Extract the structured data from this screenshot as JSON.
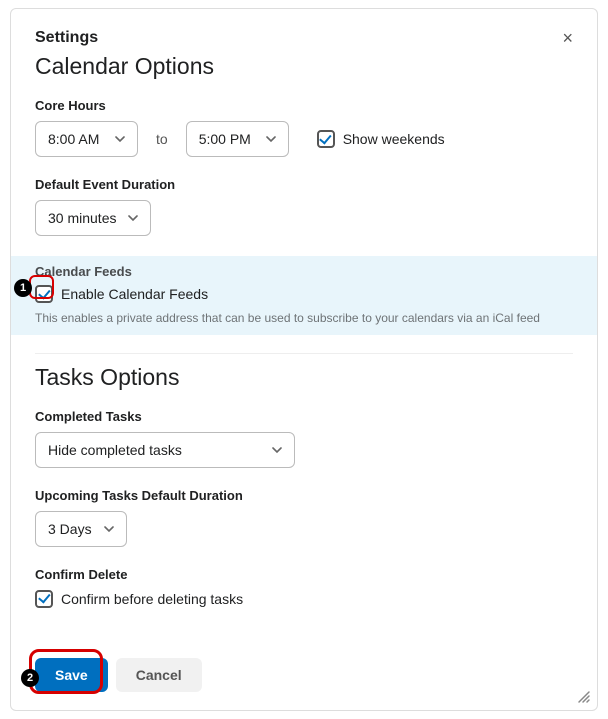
{
  "header": {
    "title": "Settings",
    "close_label": "×"
  },
  "calendar": {
    "heading": "Calendar Options",
    "core_hours": {
      "label": "Core Hours",
      "start": "8:00 AM",
      "to": "to",
      "end": "5:00 PM",
      "show_weekends_label": "Show weekends"
    },
    "default_event": {
      "label": "Default Event Duration",
      "value": "30 minutes"
    },
    "feeds": {
      "label": "Calendar Feeds",
      "enable_label": "Enable Calendar Feeds",
      "description": "This enables a private address that can be used to subscribe to your calendars via an iCal feed"
    }
  },
  "tasks": {
    "heading": "Tasks Options",
    "completed": {
      "label": "Completed Tasks",
      "value": "Hide completed tasks"
    },
    "upcoming": {
      "label": "Upcoming Tasks Default Duration",
      "value": "3 Days"
    },
    "confirm": {
      "label": "Confirm Delete",
      "checkbox_label": "Confirm before deleting tasks"
    }
  },
  "buttons": {
    "save": "Save",
    "cancel": "Cancel"
  },
  "markers": {
    "one": "1",
    "two": "2"
  }
}
